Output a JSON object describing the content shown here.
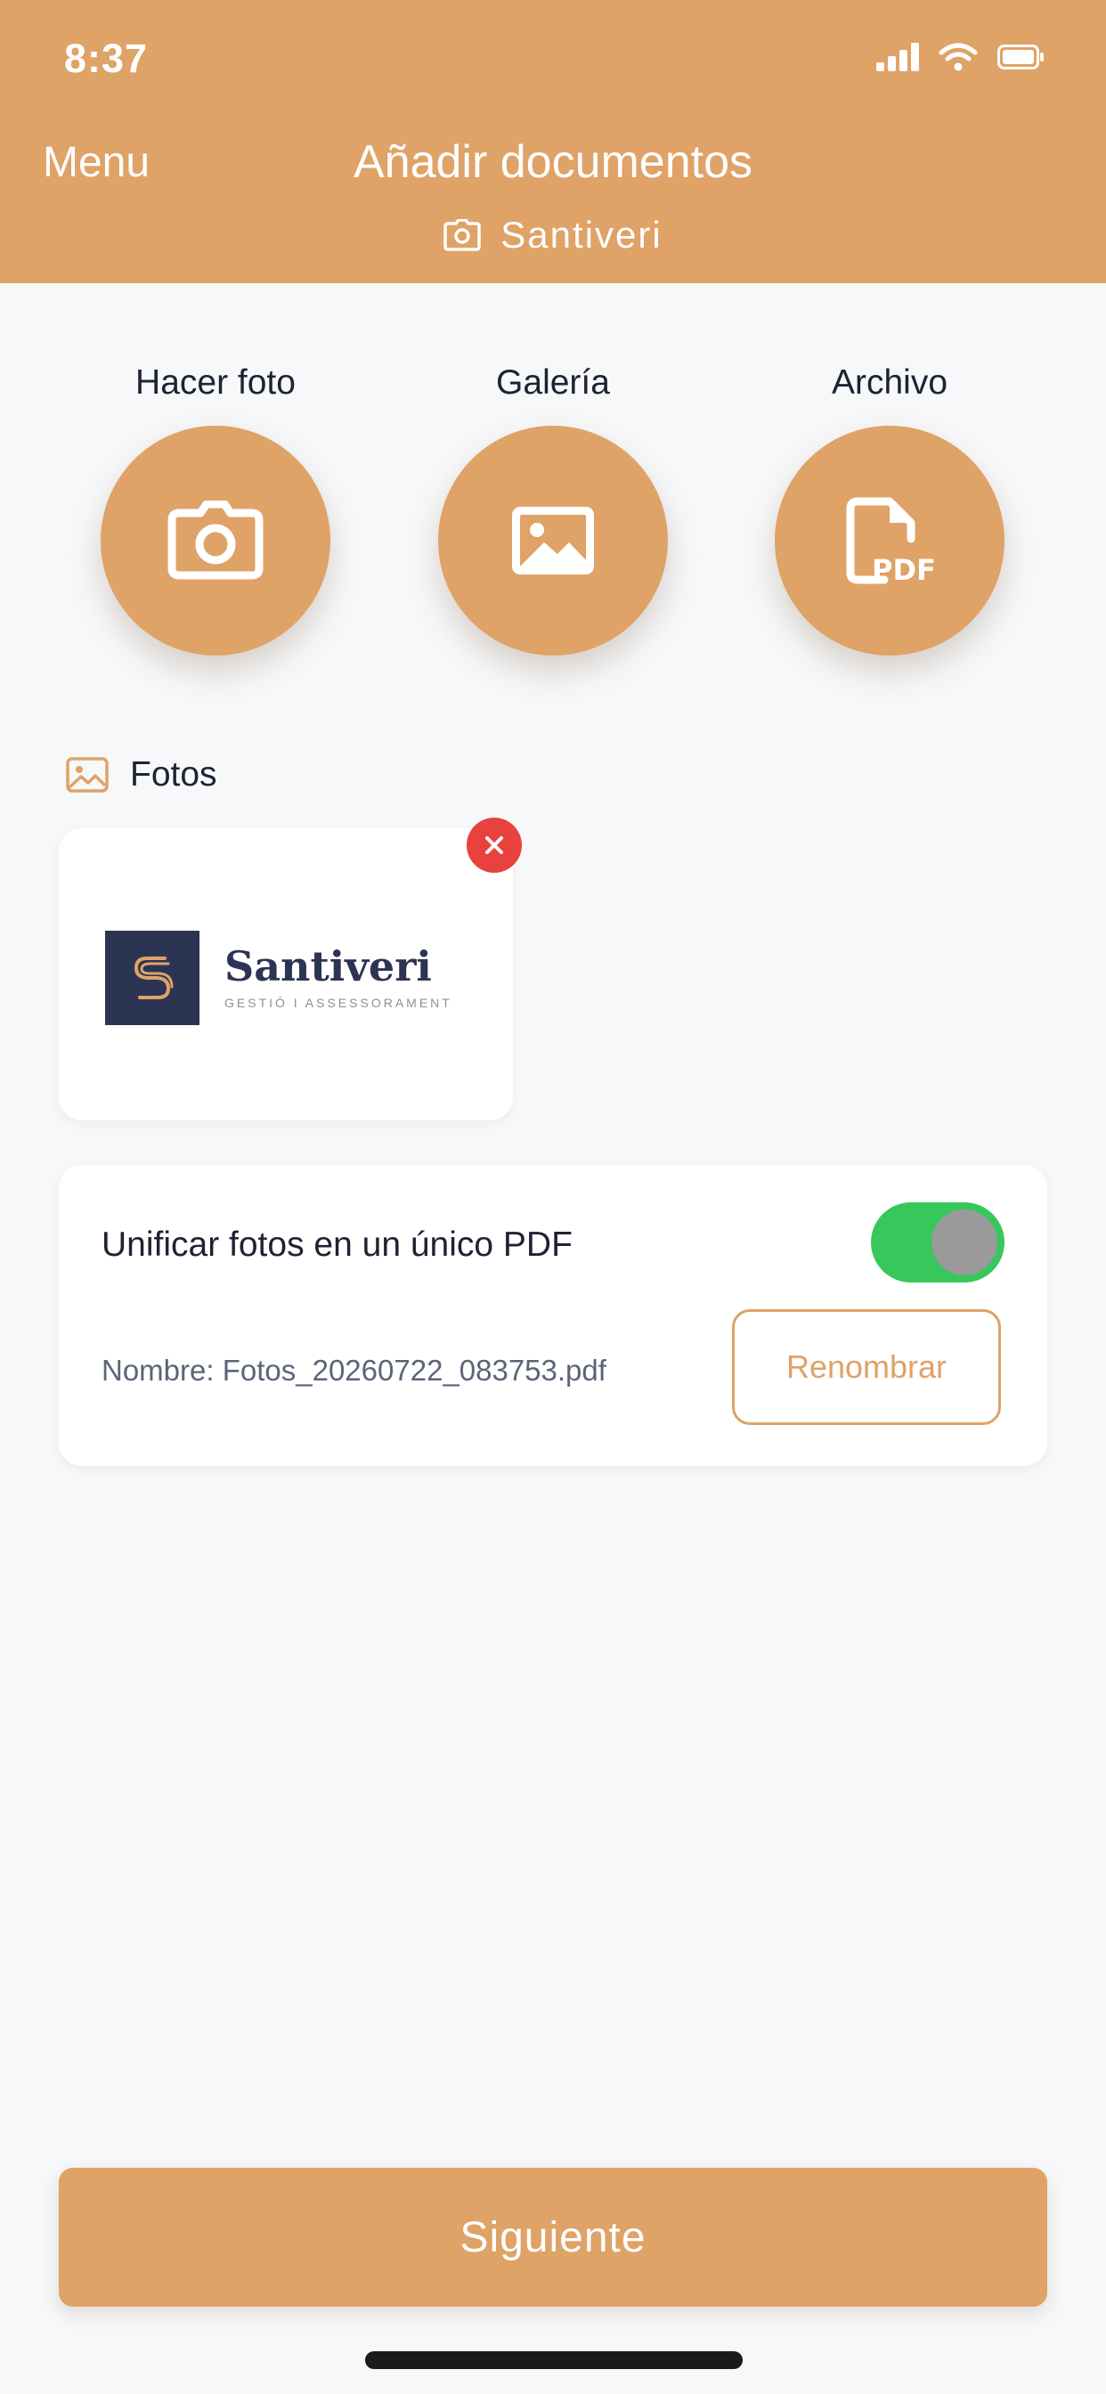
{
  "status_bar": {
    "time": "8:37",
    "icons": [
      "cellular-signal-icon",
      "wifi-icon",
      "battery-icon"
    ]
  },
  "header": {
    "menu_label": "Menu",
    "title": "Añadir documentos",
    "subtitle": "Santiveri",
    "subtitle_icon": "camera-icon"
  },
  "actions": [
    {
      "label": "Hacer foto",
      "icon": "camera-icon"
    },
    {
      "label": "Galería",
      "icon": "image-icon"
    },
    {
      "label": "Archivo",
      "icon": "pdf-file-icon"
    }
  ],
  "photos": {
    "section_label": "Fotos",
    "section_icon": "image-icon",
    "items": [
      {
        "logo_name": "Santiveri",
        "logo_tagline": "GESTIÓ I ASSESSORAMENT",
        "remove_icon": "close-icon"
      }
    ]
  },
  "pdf_options": {
    "unify_label": "Unificar fotos en un único PDF",
    "unify_enabled": true,
    "filename": "Nombre: Fotos_20260722_083753.pdf",
    "rename_label": "Renombrar"
  },
  "footer": {
    "next_label": "Siguiente"
  },
  "colors": {
    "accent": "#dfa267",
    "toggle_on": "#36c85a",
    "remove": "#e8413e",
    "logo_navy": "#2c3454",
    "background": "#f7f8fa"
  }
}
